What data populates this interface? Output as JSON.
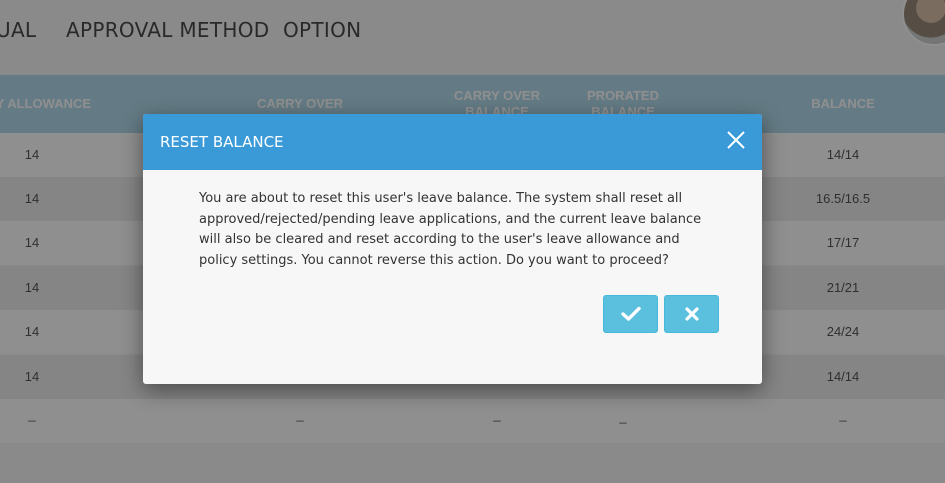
{
  "nav": {
    "tabs": [
      {
        "label": "UAL"
      },
      {
        "label": "APPROVAL METHOD"
      },
      {
        "label": "OPTION"
      }
    ]
  },
  "table": {
    "headers": [
      {
        "lines": [
          "LY ALLOWANCE"
        ]
      },
      {
        "lines": [
          "CARRY OVER"
        ]
      },
      {
        "lines": [
          "CARRY OVER",
          "BALANCE"
        ]
      },
      {
        "lines": [
          "PRORATED",
          "BALANCE"
        ]
      },
      {
        "lines": [
          "BALANCE"
        ]
      }
    ],
    "rows": [
      [
        "14",
        "",
        "",
        "",
        "14/14"
      ],
      [
        "14",
        "",
        "",
        "",
        "16.5/16.5"
      ],
      [
        "14",
        "",
        "",
        "",
        "17/17"
      ],
      [
        "14",
        "",
        "",
        "",
        "21/21"
      ],
      [
        "14",
        "",
        "",
        "",
        "24/24"
      ],
      [
        "14",
        "",
        "",
        "",
        "14/14"
      ],
      [
        "_",
        "_",
        "_",
        "_",
        "_"
      ]
    ]
  },
  "modal": {
    "title": "RESET BALANCE",
    "body_lines": [
      "You are about to reset this user's leave balance. The system shall reset all",
      "approved/rejected/pending leave applications, and the current leave balance",
      "will also be cleared and reset according to the user's leave allowance and",
      "policy settings. You cannot reverse this action. Do you want to proceed?"
    ],
    "confirm_icon": "check-icon",
    "cancel_icon": "x-icon",
    "close_icon": "close-icon"
  },
  "colors": {
    "modal_header": "#3a9ad8",
    "button": "#5bc0de",
    "table_header": "#b3dcee"
  }
}
